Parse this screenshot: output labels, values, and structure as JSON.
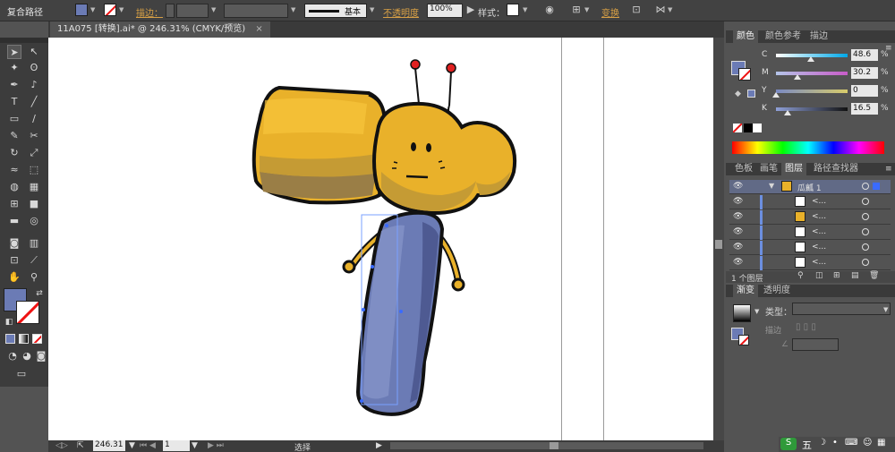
{
  "app": {
    "mode_title": "复合路径"
  },
  "control_bar": {
    "stroke_label": "描边：",
    "brush_label": "基本",
    "opacity_label": "不透明度",
    "opacity_value": "100%",
    "style_label": "样式：",
    "transform_label": "变换",
    "fill_color": "#6b7bb5",
    "accent_color": "#d8a045"
  },
  "document": {
    "tab_title": "11A075 [转换].ai* @ 246.31% (CMYK/预览)",
    "close_glyph": "×"
  },
  "status_bar": {
    "zoom": "246.31",
    "artboard": "1",
    "tool_status": "选择"
  },
  "color_panel": {
    "tabs": [
      "颜色",
      "颜色参考",
      "描边"
    ],
    "channels": [
      {
        "label": "C",
        "value": "48.6",
        "fraction": 0.486,
        "color": "#8fb8e6"
      },
      {
        "label": "M",
        "value": "30.2",
        "fraction": 0.302,
        "color": "#e07ad0"
      },
      {
        "label": "Y",
        "value": "0",
        "fraction": 0,
        "color": "#d8d48a"
      },
      {
        "label": "K",
        "value": "16.5",
        "fraction": 0.165,
        "color": "#8a8a8a"
      }
    ],
    "percent_symbol": "%"
  },
  "layers_panel": {
    "tabs": [
      "色板",
      "画笔",
      "图层",
      "路径查找器"
    ],
    "parent_layer": "瓜瓤 1",
    "items": [
      "<...",
      "<...",
      "<...",
      "<...",
      "<..."
    ],
    "count_label": "1 个图层"
  },
  "gradient_panel": {
    "tabs": [
      "渐变",
      "透明度"
    ],
    "type_label": "类型：",
    "stroke_label": "描边"
  },
  "ime": {
    "label": "五"
  }
}
